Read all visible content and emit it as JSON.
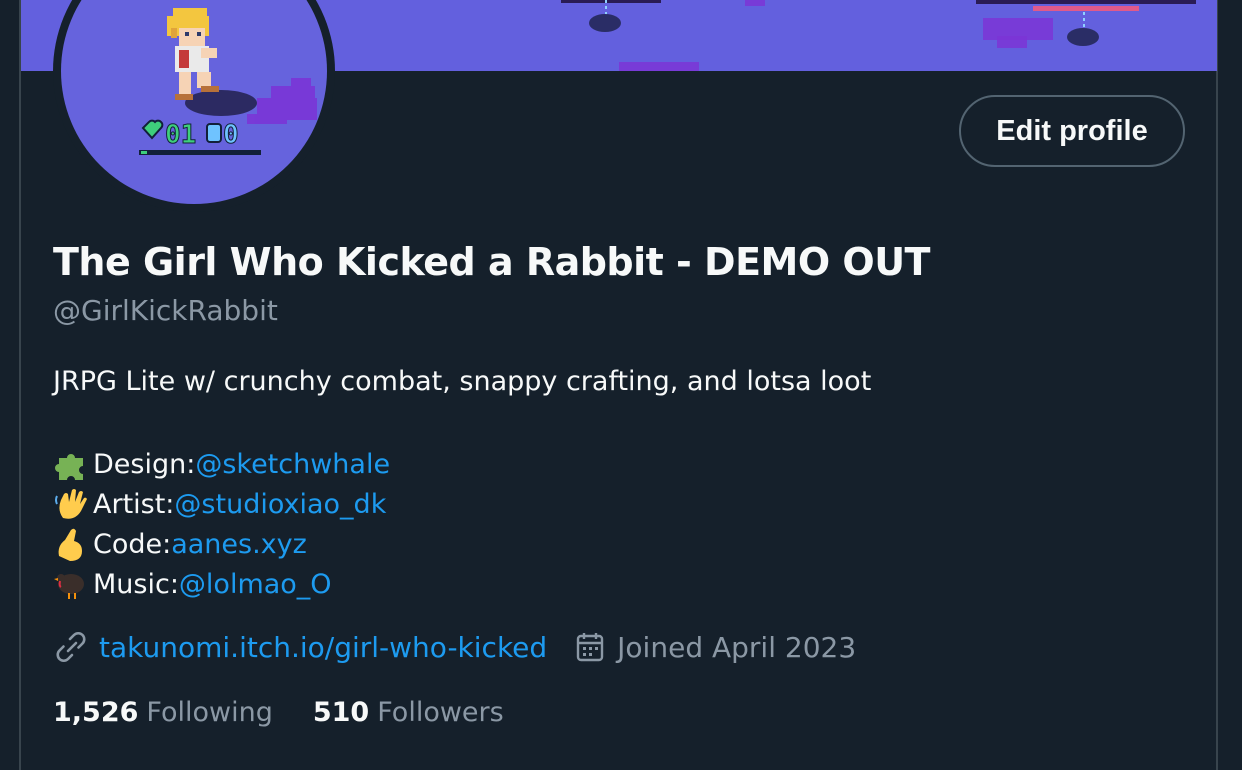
{
  "profile": {
    "display_name": "The Girl Who Kicked a Rabbit - DEMO OUT",
    "handle": "@GirlKickRabbit",
    "edit_label": "Edit profile",
    "bio": "JRPG Lite w/ crunchy combat, snappy crafting, and  lotsa loot",
    "avatar_hud": {
      "hearts": "01",
      "shields": "0"
    },
    "credits": [
      {
        "icon": "puzzle-piece-icon",
        "role": "Design: ",
        "link": "@sketchwhale"
      },
      {
        "icon": "waving-hand-icon",
        "role": "Artist: ",
        "link": "@studioxiao_dk"
      },
      {
        "icon": "pinching-hand-icon",
        "role": "Code: ",
        "link": "aanes.xyz"
      },
      {
        "icon": "turkey-icon",
        "role": "Music: ",
        "link": "@lolmao_O"
      }
    ],
    "website": "takunomi.itch.io/girl-who-kicked",
    "joined": "Joined April 2023",
    "following_count": "1,526",
    "following_label": "Following",
    "followers_count": "510",
    "followers_label": "Followers"
  },
  "colors": {
    "background": "#15202b",
    "banner": "#6360de",
    "link": "#1d9bf0",
    "muted": "#8b98a5"
  }
}
